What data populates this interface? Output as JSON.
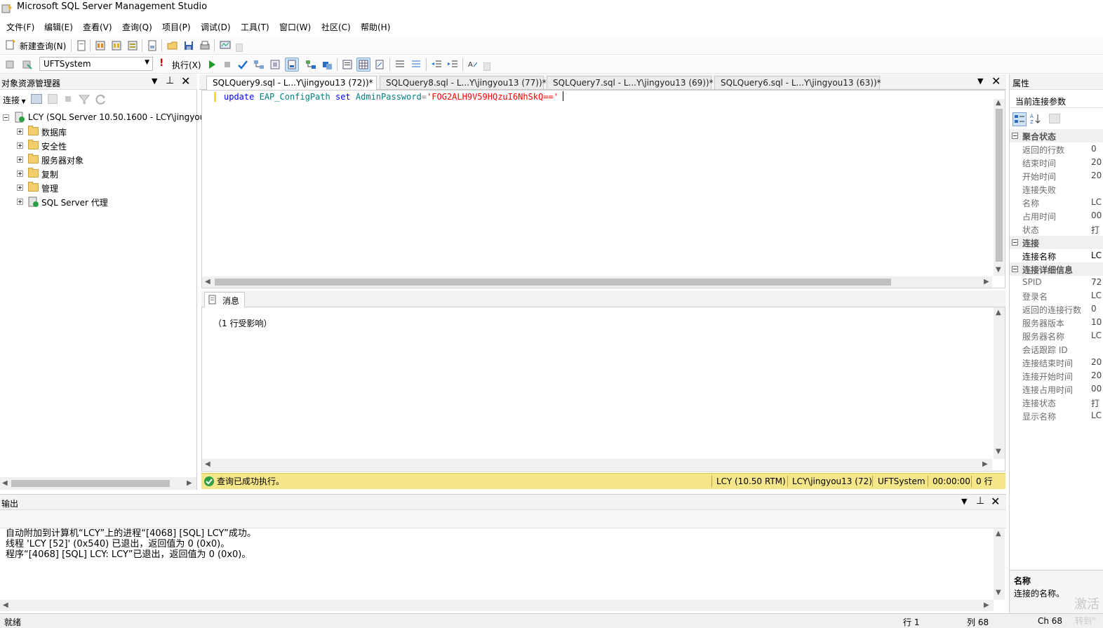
{
  "window": {
    "title": "Microsoft SQL Server Management Studio"
  },
  "menu": [
    "文件(F)",
    "编辑(E)",
    "查看(V)",
    "查询(Q)",
    "项目(P)",
    "调试(D)",
    "工具(T)",
    "窗口(W)",
    "社区(C)",
    "帮助(H)"
  ],
  "toolbar1": {
    "new_query_label": "新建查询(N)"
  },
  "toolbar2": {
    "database_select": "UFTSystem",
    "execute_label": "执行(X)"
  },
  "object_explorer": {
    "title": "对象资源管理器",
    "connect_label": "连接",
    "server_node": "LCY (SQL Server 10.50.1600 - LCY\\jingyou",
    "children": [
      "数据库",
      "安全性",
      "服务器对象",
      "复制",
      "管理",
      "SQL Server 代理"
    ]
  },
  "tabs": [
    "SQLQuery9.sql - L...Y\\jingyou13 (72))*",
    "SQLQuery8.sql - L...Y\\jingyou13 (77))*",
    "SQLQuery7.sql - L...Y\\jingyou13 (69))*",
    "SQLQuery6.sql - L...Y\\jingyou13 (63))*"
  ],
  "editor": {
    "kw_update": "update",
    "table": "EAP_ConfigPath",
    "kw_set": "set",
    "column": "AdminPassword",
    "op": "=",
    "value": "'FOG2ALH9V59HQzuI6NhSkQ=='"
  },
  "results": {
    "tab_label": "消息",
    "message": "（1 行受影响）"
  },
  "query_status": {
    "message": "查询已成功执行。",
    "server": "LCY (10.50 RTM)",
    "user": "LCY\\jingyou13 (72)",
    "database": "UFTSystem",
    "time": "00:00:00",
    "rows": "0 行"
  },
  "output": {
    "title": "输出",
    "lines": [
      "自动附加到计算机“LCY”上的进程“[4068] [SQL] LCY”成功。",
      "线程 'LCY [52]' (0x540) 已退出，返回值为 0 (0x0)。",
      "程序“[4068] [SQL] LCY: LCY”已退出，返回值为 0 (0x0)。"
    ]
  },
  "properties": {
    "title": "属性",
    "object": "当前连接参数",
    "categories": {
      "aggregate": "聚合状态",
      "connection": "连接",
      "connection_details": "连接详细信息"
    },
    "aggregate_rows": [
      {
        "name": "返回的行数",
        "value": "0"
      },
      {
        "name": "结束时间",
        "value": "20"
      },
      {
        "name": "开始时间",
        "value": "20"
      },
      {
        "name": "连接失败",
        "value": ""
      },
      {
        "name": "名称",
        "value": "LC"
      },
      {
        "name": "占用时间",
        "value": "00"
      },
      {
        "name": "状态",
        "value": "打"
      }
    ],
    "connection_rows": [
      {
        "name": "连接名称",
        "value": "LC"
      }
    ],
    "detail_rows": [
      {
        "name": "SPID",
        "value": "72"
      },
      {
        "name": "登录名",
        "value": "LC"
      },
      {
        "name": "返回的连接行数",
        "value": "0"
      },
      {
        "name": "服务器版本",
        "value": "10"
      },
      {
        "name": "服务器名称",
        "value": "LC"
      },
      {
        "name": "会话跟踪 ID",
        "value": ""
      },
      {
        "name": "连接结束时间",
        "value": "20"
      },
      {
        "name": "连接开始时间",
        "value": "20"
      },
      {
        "name": "连接占用时间",
        "value": "00"
      },
      {
        "name": "连接状态",
        "value": "打"
      },
      {
        "name": "显示名称",
        "value": "LC"
      }
    ],
    "desc_title": "名称",
    "desc_text": "连接的名称。"
  },
  "statusbar": {
    "ready": "就绪",
    "line": "行 1",
    "col": "列 68",
    "ch": "Ch 68",
    "watermark1": "激活",
    "watermark2": "转到\""
  }
}
